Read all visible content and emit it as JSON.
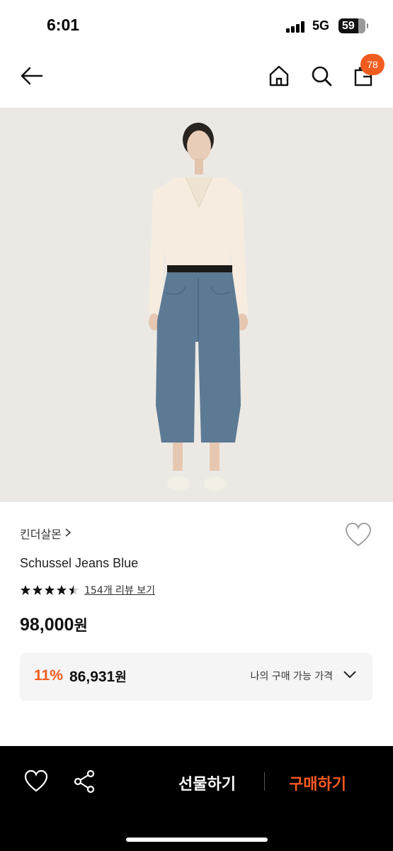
{
  "status_bar": {
    "time": "6:01",
    "network": "5G",
    "battery": "59"
  },
  "header": {
    "cart_count": "78",
    "icons": [
      "back-arrow-icon",
      "home-icon",
      "search-icon",
      "shopping-bag-icon"
    ]
  },
  "product": {
    "brand": "킨더살몬",
    "name": "Schussel Jeans Blue",
    "rating": 4.5,
    "review_link": "154개 리뷰 보기",
    "price": "98,000",
    "price_unit": "원",
    "discount_rate": "11%",
    "discount_price": "86,931",
    "my_price_label": "나의 구매 가능 가격"
  },
  "bottom_bar": {
    "gift_label": "선물하기",
    "buy_label": "구매하기"
  },
  "colors": {
    "accent": "#f25c1f",
    "bottom_bar_bg": "#000000",
    "image_bg": "#ece9e4"
  }
}
